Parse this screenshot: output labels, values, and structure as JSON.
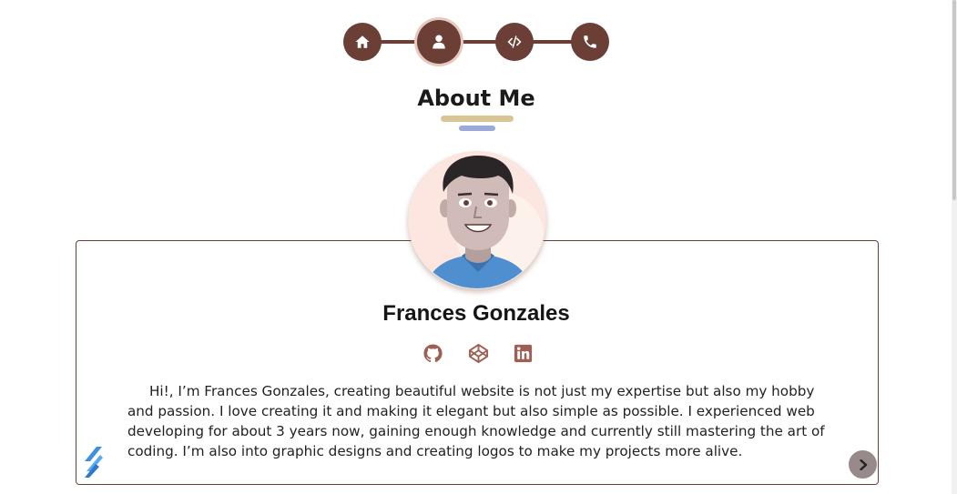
{
  "nav": {
    "steps": [
      {
        "name": "home",
        "icon": "home-icon",
        "active": false
      },
      {
        "name": "about",
        "icon": "user-icon",
        "active": true
      },
      {
        "name": "projects",
        "icon": "code-icon",
        "active": false
      },
      {
        "name": "contact",
        "icon": "phone-icon",
        "active": false
      }
    ]
  },
  "section": {
    "title": "About Me"
  },
  "profile": {
    "name": "Frances Gonzales",
    "avatar_icon": "avatar-illustration",
    "socials": [
      {
        "icon": "github-icon"
      },
      {
        "icon": "codepen-icon"
      },
      {
        "icon": "linkedin-icon"
      }
    ],
    "bio": "Hi!, I’m Frances Gonzales, creating beautiful website is not just my expertise but also my hobby and passion. I love creating it and making it elegant but also simple as possible. I experienced web developing for about 3 years now, gaining enough knowledge and currently still mastering the art of coding. I’m also into graphic designs and creating logos to make my projects more alive."
  },
  "controls": {
    "next_icon": "chevron-right-icon",
    "logo_icon": "brand-logo-icon"
  },
  "colors": {
    "primary": "#6b3f36",
    "gold": "#d9c493",
    "blue": "#9aa9da",
    "social": "#a05f55",
    "next_button": "#988a8a"
  }
}
